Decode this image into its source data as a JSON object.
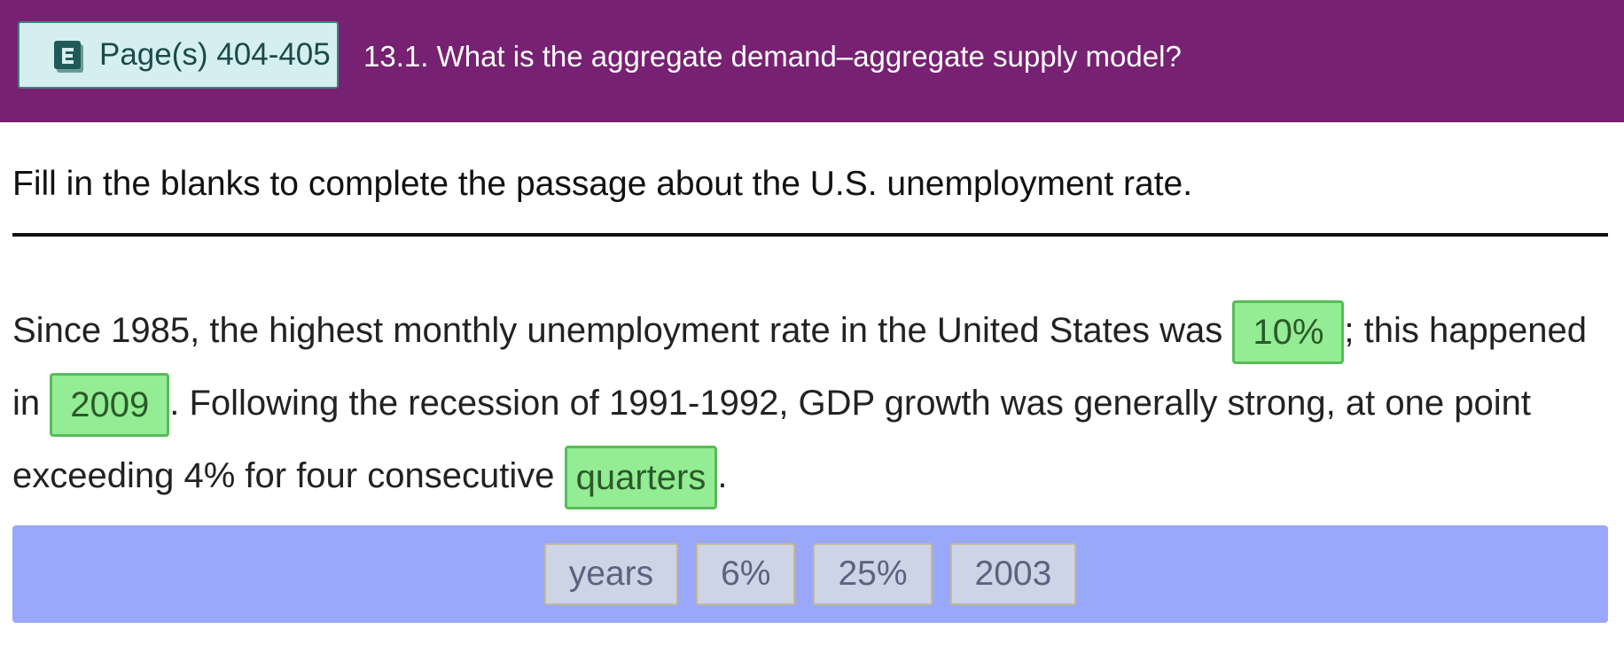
{
  "header": {
    "page_button_label": "Page(s) 404-405",
    "title": "13.1. What is the aggregate demand–aggregate supply model?",
    "background_color": "#772173",
    "page_button_icon": "ebook-icon"
  },
  "instruction": "Fill in the blanks to complete the passage about the U.S. unemployment rate.",
  "passage": {
    "text_1": "Since 1985, the highest monthly unemployment rate in the United States was ",
    "blank_1": "10%",
    "text_2": "; this happened in ",
    "blank_2": "2009",
    "text_3": ". Following the recession of 1991-1992, GDP growth was generally strong, at one point exceeding 4% for four consecutive ",
    "blank_3": "quarters",
    "text_4": "."
  },
  "word_bank": {
    "options": [
      "years",
      "6%",
      "25%",
      "2003"
    ],
    "background_color": "#9aa8fb"
  },
  "colors": {
    "filled_blank": "#94ec94",
    "filled_blank_border": "#56bd56"
  }
}
